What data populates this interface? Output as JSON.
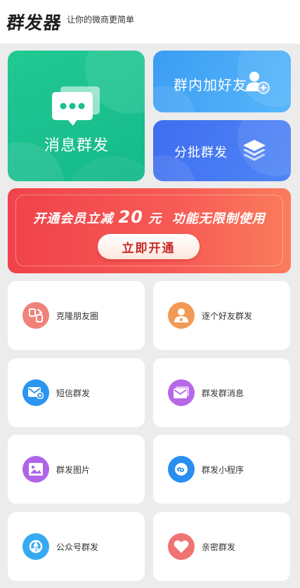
{
  "header": {
    "logo": "群发器",
    "slogan": "让你的微商更简单"
  },
  "feature_cards": {
    "broadcast": {
      "label": "消息群发",
      "icon": "chat-bubbles-icon"
    },
    "group_add_friend": {
      "label": "群内加好友",
      "icon": "add-user-icon"
    },
    "batch_send": {
      "label": "分批群发",
      "icon": "layers-icon"
    }
  },
  "banner": {
    "title_before": "开通会员立减",
    "title_number": "20",
    "title_unit": "元",
    "title_after": "功能无限制使用",
    "button": "立即开通"
  },
  "tiles": [
    {
      "label": "克隆朋友圈",
      "icon": "clone-icon",
      "color": "#f0827a"
    },
    {
      "label": "逐个好友群发",
      "icon": "person-icon",
      "color": "#f29a55"
    },
    {
      "label": "短信群发",
      "icon": "sms-icon",
      "color": "#2b95f2"
    },
    {
      "label": "群发群消息",
      "icon": "message-icon",
      "color": "#b768e6"
    },
    {
      "label": "群发图片",
      "icon": "image-icon",
      "color": "#b065e8"
    },
    {
      "label": "群发小程序",
      "icon": "mini-program-icon",
      "color": "#2a8ef0"
    },
    {
      "label": "公众号群发",
      "icon": "official-account-icon",
      "color": "#36aaf0"
    },
    {
      "label": "亲密群发",
      "icon": "heart-icon",
      "color": "#f07373"
    }
  ]
}
